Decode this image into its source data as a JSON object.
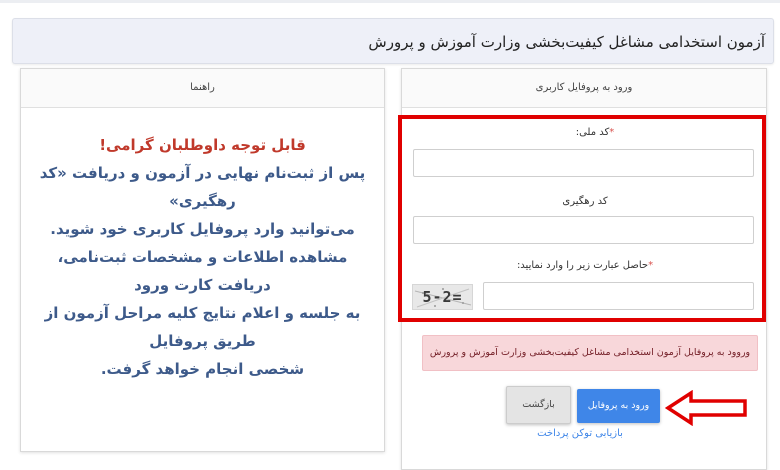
{
  "header": {
    "title": "آزمون استخدامی مشاغل کیفیت‌بخشی وزارت آموزش و پرورش"
  },
  "guide_panel": {
    "title": "راهنما",
    "warning": "قابل توجه داوطلبان گرامی!",
    "lines": [
      "پس از ثبت‌نام نهایی در آزمون و دریافت «کد رهگیری»",
      "می‌توانید وارد پروفایل کاربری خود شوید.",
      "مشاهده اطلاعات و مشخصات ثبت‌نامی، دریافت کارت ورود",
      "به جلسه و اعلام نتایج کلیه مراحل آزمون از طریق پروفایل",
      "شخصی انجام خواهد گرفت."
    ]
  },
  "login_panel": {
    "title": "ورود به پروفایل کاربری",
    "national_code_label": "کد ملی:",
    "national_code_value": "",
    "tracking_code_label": "کد رهگیری",
    "tracking_code_value": "",
    "captcha_label": "حاصل عبارت زیر را وارد نمایید:",
    "captcha_value": "",
    "captcha_text": "5-2=",
    "required_mark": "*",
    "alert": "وروود به پروفایل آزمون استخدامی مشاغل کیفیت‌بخشی وزارت آموزش و پرورش",
    "login_button": "ورود به پروفایل",
    "back_button": "بازگشت",
    "recover_link": "بازیابی توکن پرداخت"
  },
  "colors": {
    "annotation_red": "#e00000",
    "primary": "#3f86e8",
    "alert_bg": "#f8d7da"
  },
  "icons": {
    "annotation_arrow": "left-arrow-outline-icon"
  }
}
